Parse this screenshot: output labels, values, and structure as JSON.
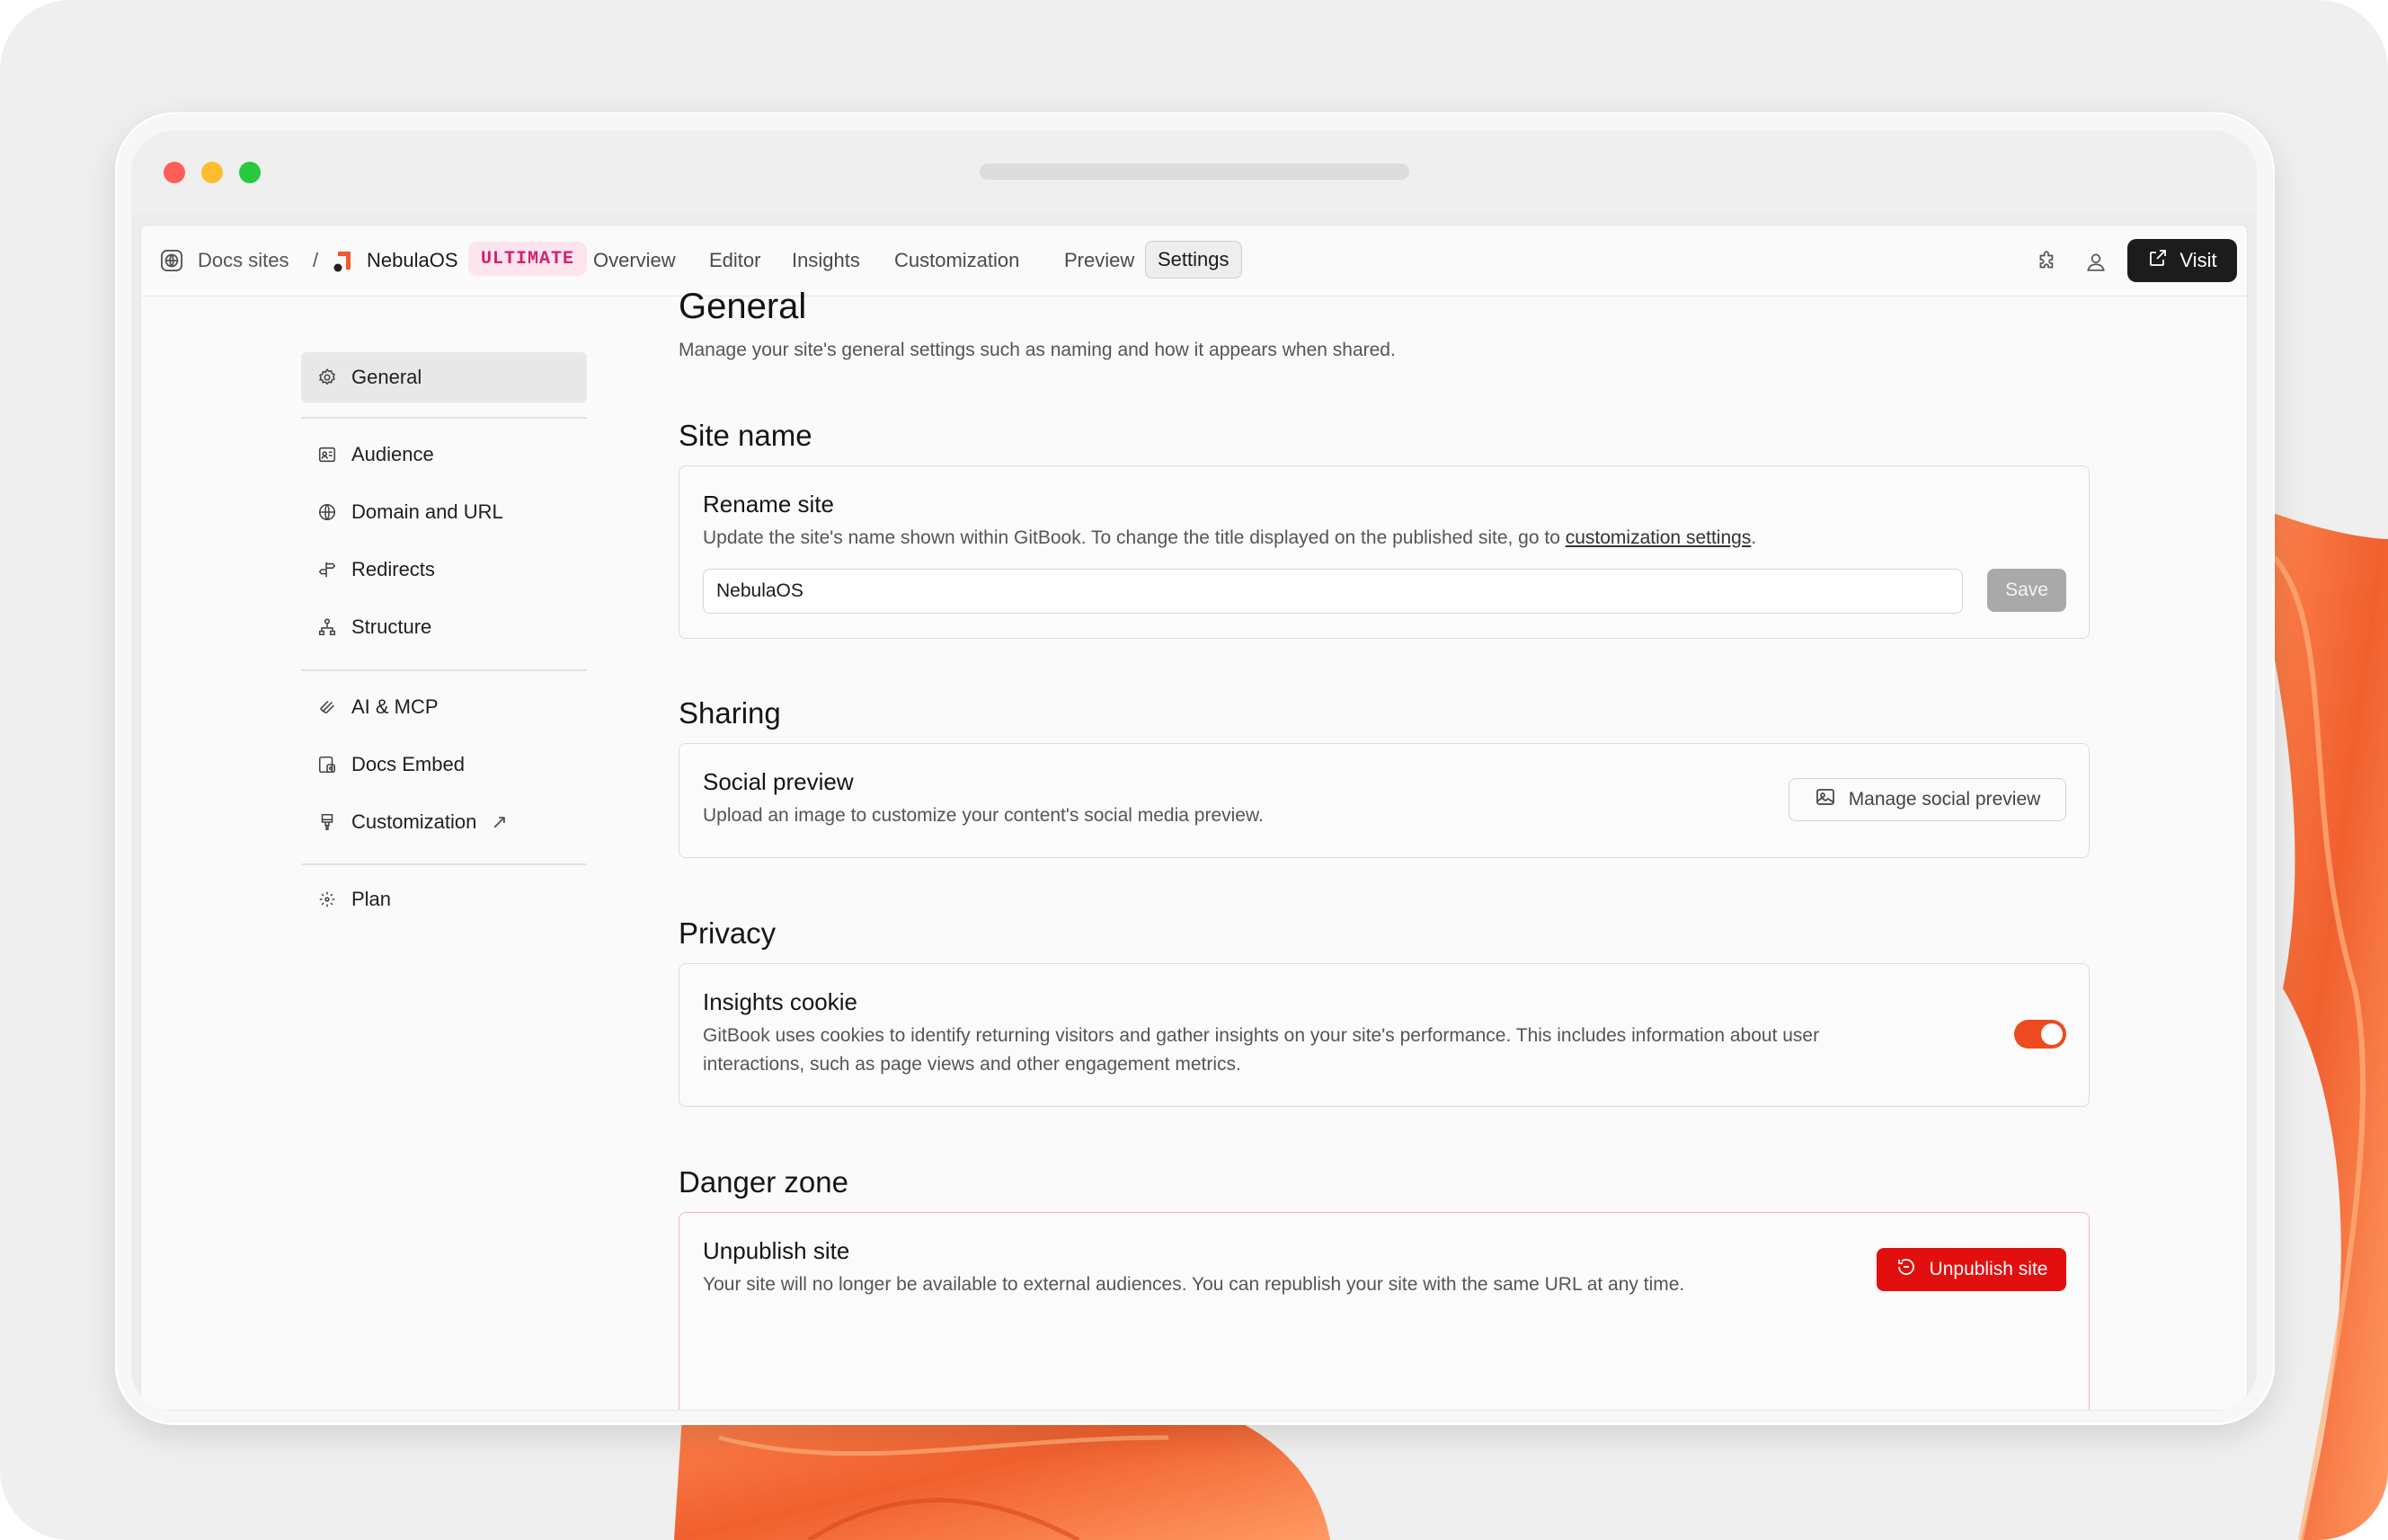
{
  "colors": {
    "accent": "#ee4a1f",
    "danger": "#e30e0e",
    "badge_bg": "#fbe4ee",
    "badge_text": "#d1216e"
  },
  "topnav": {
    "breadcrumb_root": "Docs sites",
    "separator": "/",
    "site_name": "NebulaOS",
    "plan_badge": "ULTIMATE",
    "tabs": [
      {
        "label": "Overview"
      },
      {
        "label": "Editor"
      },
      {
        "label": "Insights"
      },
      {
        "label": "Customization"
      },
      {
        "label": "Preview"
      },
      {
        "label": "Settings",
        "active": true
      }
    ],
    "visit_label": "Visit",
    "icons": [
      "globe-icon",
      "site-logo-icon",
      "puzzle-icon",
      "user-icon",
      "external-link-icon"
    ]
  },
  "sidebar": {
    "groups": [
      [
        {
          "label": "General",
          "icon": "gear-icon",
          "active": true
        }
      ],
      [
        {
          "label": "Audience",
          "icon": "audience-icon"
        },
        {
          "label": "Domain and URL",
          "icon": "globe-icon"
        },
        {
          "label": "Redirects",
          "icon": "signpost-icon"
        },
        {
          "label": "Structure",
          "icon": "structure-icon"
        }
      ],
      [
        {
          "label": "AI & MCP",
          "icon": "ai-icon"
        },
        {
          "label": "Docs Embed",
          "icon": "embed-icon"
        },
        {
          "label": "Customization",
          "icon": "paintbrush-icon",
          "external": "↗"
        }
      ],
      [
        {
          "label": "Plan",
          "icon": "plan-icon"
        }
      ]
    ]
  },
  "main": {
    "title": "General",
    "subtitle": "Manage your site's general settings such as naming and how it appears when shared.",
    "site_name_section": {
      "heading": "Site name",
      "card_title": "Rename site",
      "desc_before": "Update the site's name shown within GitBook. To change the title displayed on the published site, go to ",
      "desc_link": "customization settings",
      "desc_after": ".",
      "input_value": "NebulaOS",
      "save_label": "Save"
    },
    "sharing_section": {
      "heading": "Sharing",
      "card_title": "Social preview",
      "desc": "Upload an image to customize your content's social media preview.",
      "button_label": "Manage social preview"
    },
    "privacy_section": {
      "heading": "Privacy",
      "card_title": "Insights cookie",
      "desc": "GitBook uses cookies to identify returning visitors and gather insights on your site's performance. This includes information about user interactions, such as page views and other engagement metrics.",
      "toggle_on": true
    },
    "danger_section": {
      "heading": "Danger zone",
      "card_title": "Unpublish site",
      "desc": "Your site will no longer be available to external audiences. You can republish your site with the same URL at any time.",
      "button_label": "Unpublish site"
    }
  }
}
